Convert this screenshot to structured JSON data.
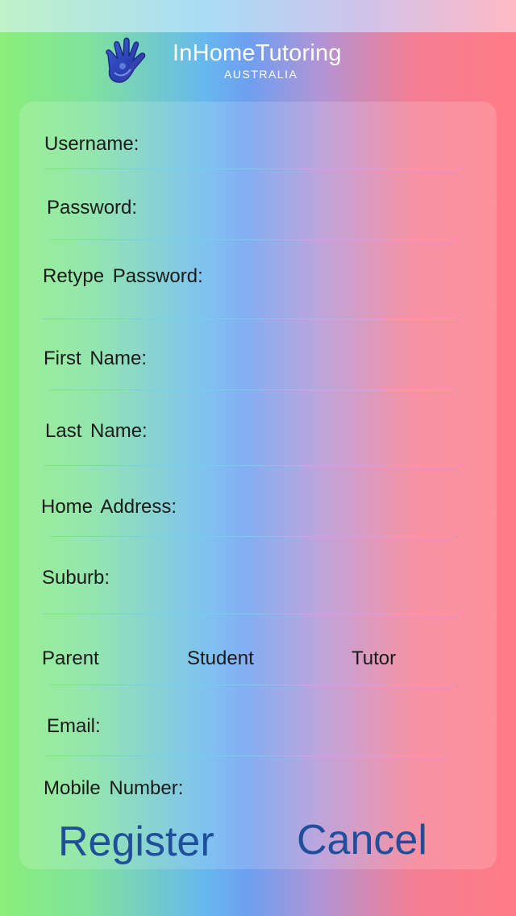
{
  "brand": {
    "title": "InHomeTutoring",
    "subtitle": "AUSTRALIA"
  },
  "form": {
    "username_label": "Username:",
    "password_label": "Password:",
    "retype_password_label": "Retype Password:",
    "first_name_label": "First Name:",
    "last_name_label": "Last Name:",
    "home_address_label": "Home Address:",
    "suburb_label": "Suburb:",
    "roles": [
      "Parent",
      "Student",
      "Tutor"
    ],
    "email_label": "Email:",
    "mobile_label": "Mobile Number:"
  },
  "actions": {
    "register_label": "Register",
    "cancel_label": "Cancel"
  },
  "colors": {
    "button_text": "#1f4f9a",
    "divider": "#78cdeb"
  }
}
